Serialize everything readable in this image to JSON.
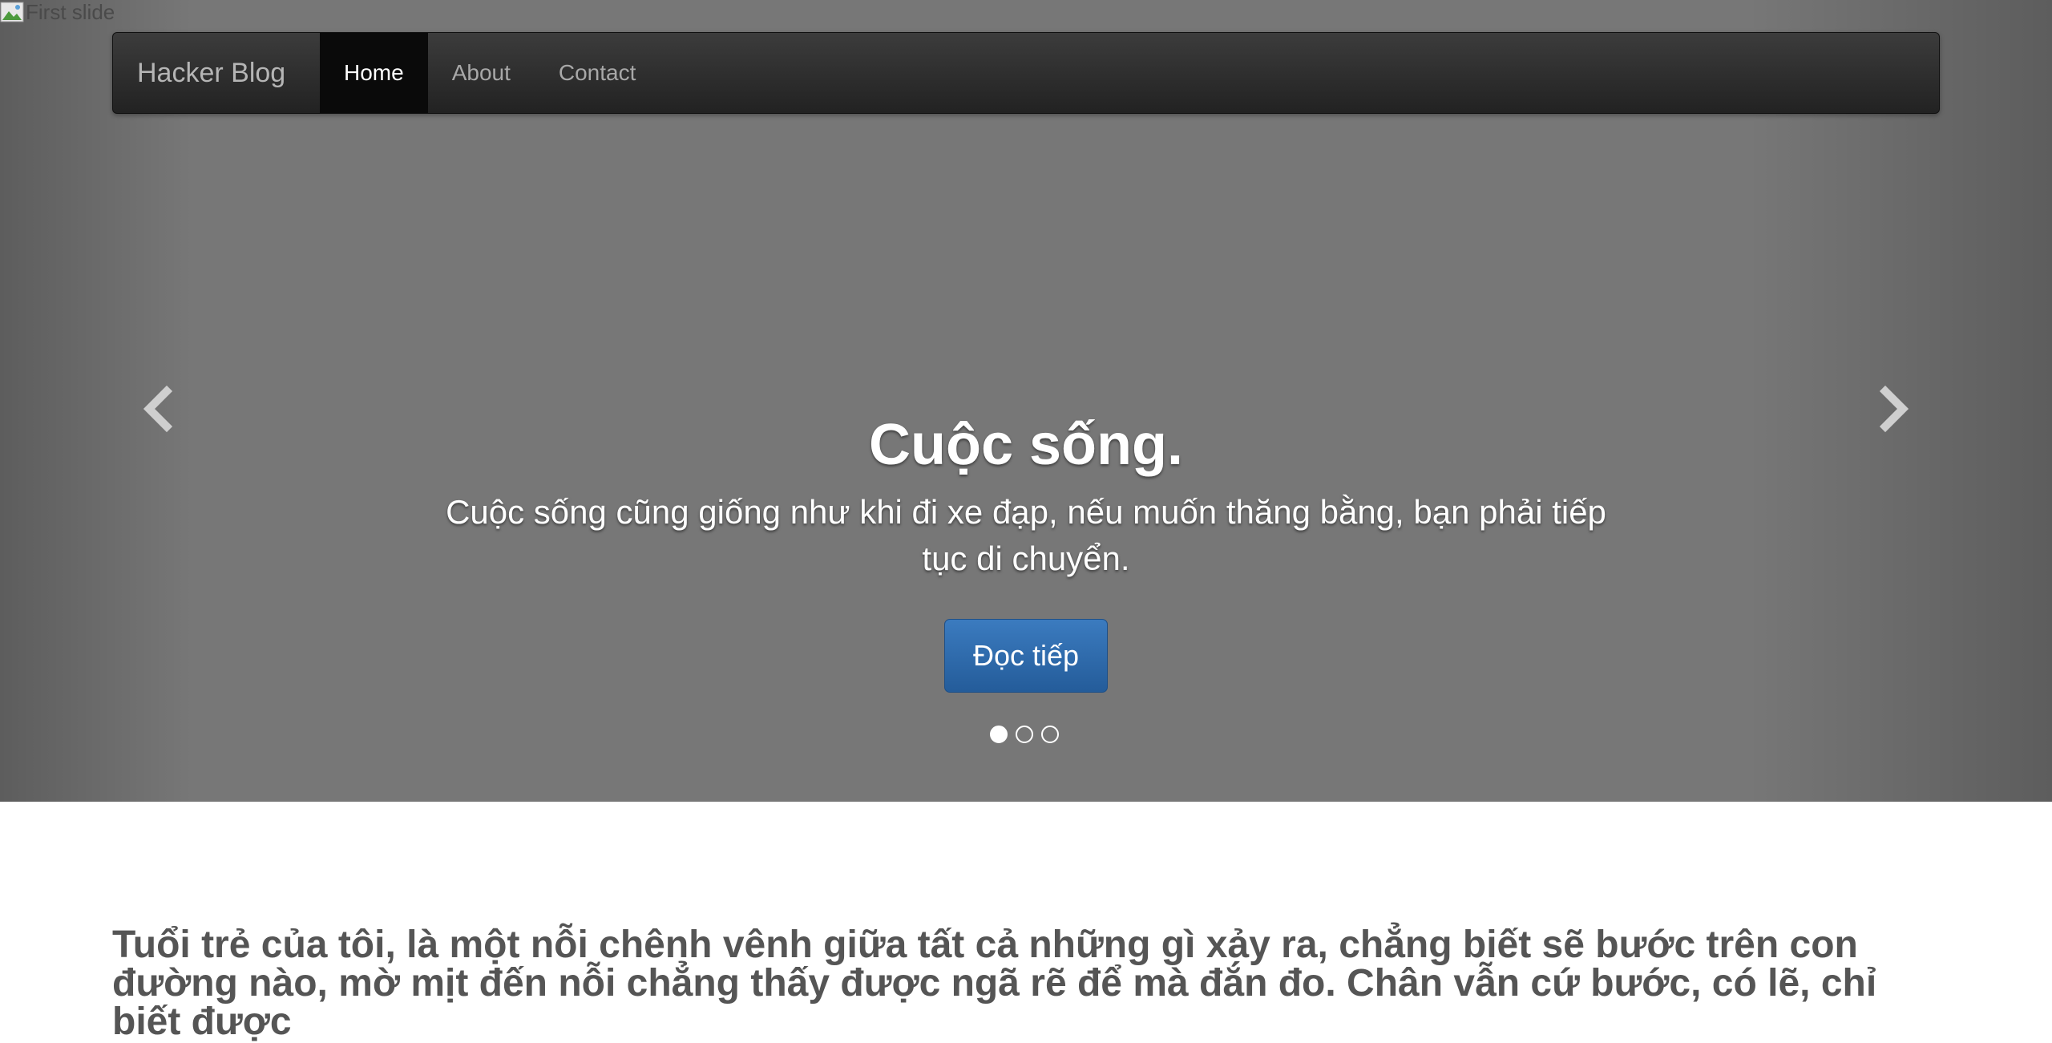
{
  "broken_image": {
    "alt": "First slide"
  },
  "navbar": {
    "brand": "Hacker Blog",
    "items": [
      {
        "label": "Home",
        "active": true
      },
      {
        "label": "About",
        "active": false
      },
      {
        "label": "Contact",
        "active": false
      }
    ]
  },
  "carousel": {
    "heading": "Cuộc sống.",
    "text": "Cuộc sống cũng giống như khi đi xe đạp, nếu muốn thăng bằng, bạn phải tiếp tục di chuyển.",
    "button_label": "Đọc tiếp",
    "active_slide": 1,
    "slide_count": 3
  },
  "content": {
    "lead": "Tuổi trẻ của tôi, là một nỗi chênh vênh giữa tất cả những gì xảy ra, chẳng biết sẽ bước trên con đường nào, mờ mịt đến nỗi chẳng thấy được ngã rẽ để mà đắn đo. Chân vẫn cứ bước, có lẽ, chỉ biết được"
  },
  "colors": {
    "carousel_bg": "#777777",
    "navbar_bg": "#2a2a2a",
    "button_primary": "#2f6fb0",
    "text_heading": "#555555"
  }
}
